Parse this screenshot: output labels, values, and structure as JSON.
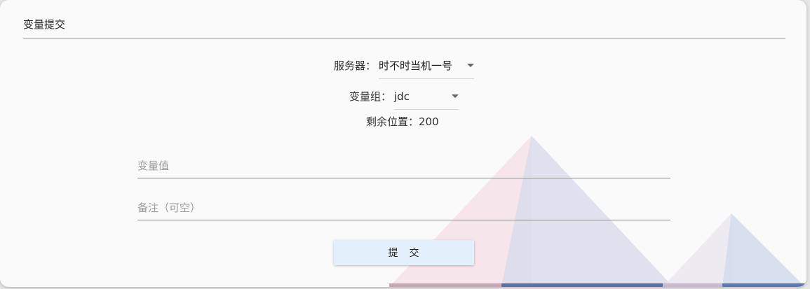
{
  "card": {
    "title": "变量提交"
  },
  "server": {
    "label": "服务器：",
    "value": "时不时当机一号"
  },
  "group": {
    "label": "变量组：",
    "value": "jdc"
  },
  "remaining": {
    "text": "剩余位置：200"
  },
  "variable_field": {
    "placeholder": "变量值",
    "value": ""
  },
  "note_field": {
    "placeholder": "备注（可空）",
    "value": ""
  },
  "submit": {
    "label": "提　交"
  },
  "icons": {
    "select_caret": "caret-down-icon"
  },
  "colors": {
    "card_background": "#fafafa",
    "button_background": "#e3f0fb",
    "triangle_pink": "#f7dde6",
    "triangle_blue": "#c7cfea",
    "triangle_dark_blue": "#5a77b8"
  }
}
